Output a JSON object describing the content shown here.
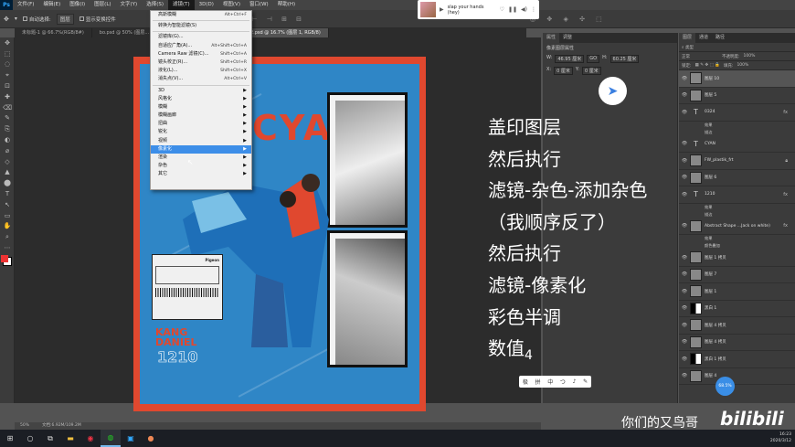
{
  "app": {
    "logo": "Ps"
  },
  "menubar": [
    "文件(F)",
    "编辑(E)",
    "图像(I)",
    "图层(L)",
    "文字(Y)",
    "选择(S)",
    "滤镜(T)",
    "3D(D)",
    "视图(V)",
    "窗口(W)",
    "帮助(H)"
  ],
  "options": {
    "auto_select": "自动选择:",
    "layer": "图层",
    "show_transform": "显示变换控件"
  },
  "tabs": [
    "未标题-1 @ 66.7%(RGB/8#)",
    "bo.psd @ 50% (图层...",
    "...(RGB/8#) ×",
    "CX_FW_Sticker_12.psd @ 16.7% (图层 1, RGB/8)"
  ],
  "filter_menu": [
    {
      "label": "高斯模糊",
      "shortcut": "Alt+Ctrl+F"
    },
    {
      "sep": true
    },
    {
      "label": "转换为智能滤镜(S)"
    },
    {
      "sep": true
    },
    {
      "label": "滤镜库(G)..."
    },
    {
      "label": "自适应广角(A)...",
      "shortcut": "Alt+Shift+Ctrl+A"
    },
    {
      "label": "Camera Raw 滤镜(C)...",
      "shortcut": "Shift+Ctrl+A"
    },
    {
      "label": "镜头校正(R)...",
      "shortcut": "Shift+Ctrl+R"
    },
    {
      "label": "液化(L)...",
      "shortcut": "Shift+Ctrl+X"
    },
    {
      "label": "消失点(V)...",
      "shortcut": "Alt+Ctrl+V"
    },
    {
      "sep": true
    },
    {
      "label": "3D",
      "sub": true
    },
    {
      "label": "风格化",
      "sub": true
    },
    {
      "label": "模糊",
      "sub": true
    },
    {
      "label": "模糊画廊",
      "sub": true
    },
    {
      "label": "扭曲",
      "sub": true
    },
    {
      "label": "锐化",
      "sub": true
    },
    {
      "label": "视频",
      "sub": true
    },
    {
      "label": "像素化",
      "sub": true,
      "highlight": true
    },
    {
      "label": "渲染",
      "sub": true
    },
    {
      "label": "杂色",
      "sub": true
    },
    {
      "label": "其它",
      "sub": true
    }
  ],
  "music": {
    "title": "slap your hands (hey)"
  },
  "poster": {
    "cyan": "CYAN",
    "name": "KANG DANIEL",
    "num": "1210",
    "card_title": "Pigeon"
  },
  "properties": {
    "tabs": [
      "属性",
      "调整"
    ],
    "subtitle": "像素图层属性",
    "w_label": "W:",
    "w_value": "46.95 厘米",
    "go": "GO",
    "h_label": "H:",
    "h_value": "60.25 厘米",
    "x_label": "X:",
    "x_value": "0 厘米",
    "y_label": "Y:",
    "y_value": "0 厘米"
  },
  "layers_panel": {
    "tabs": [
      "图层",
      "通道",
      "路径"
    ],
    "kind": "类型",
    "blend": "正常",
    "opacity_label": "不透明度:",
    "opacity": "100%",
    "lock_label": "锁定:",
    "fill_label": "填充:",
    "fill": "100%",
    "items": [
      {
        "name": "图层 10",
        "type": "px",
        "sel": true
      },
      {
        "name": "图层 5",
        "type": "px"
      },
      {
        "name": "0324",
        "type": "text",
        "fx": true,
        "subs": [
          "效果",
          "描边"
        ]
      },
      {
        "name": "CYAN",
        "type": "text"
      },
      {
        "name": "FW_plastik_frt",
        "type": "px",
        "lock": true
      },
      {
        "name": "图层 6",
        "type": "px"
      },
      {
        "name": "1210",
        "type": "text",
        "fx": true,
        "subs": [
          "效果",
          "描边"
        ]
      },
      {
        "name": "Abstract Shape ...Jack on white)",
        "type": "px",
        "fx": true,
        "subs": [
          "效果",
          "颜色叠加"
        ]
      },
      {
        "name": "图层 1 拷贝",
        "type": "px"
      },
      {
        "name": "图层 7",
        "type": "px"
      },
      {
        "name": "图层 1",
        "type": "px"
      },
      {
        "name": "黑白 1",
        "type": "adj"
      },
      {
        "name": "图层 4 拷贝",
        "type": "px"
      },
      {
        "name": "图层 4 拷贝",
        "type": "px"
      },
      {
        "name": "黑白 1 拷贝",
        "type": "adj"
      },
      {
        "name": "图层 4",
        "type": "px"
      }
    ],
    "badge": "68.5%"
  },
  "overlay_lines": [
    "盖印图层",
    "然后执行",
    "滤镜-杂色-添加杂色",
    "（我顺序反了）",
    "然后执行",
    "滤镜-像素化",
    "彩色半调",
    "数值"
  ],
  "overlay_value": "4",
  "ime": [
    "极",
    "拼",
    "中",
    "つ",
    "♪",
    "✎"
  ],
  "status": {
    "zoom": "50%",
    "doc": "文档:6.92M/109.2M"
  },
  "watermark": "你们的又鸟哥",
  "bili": "bilibili",
  "tray": {
    "time": "16:23",
    "date": "2020/3/12"
  }
}
